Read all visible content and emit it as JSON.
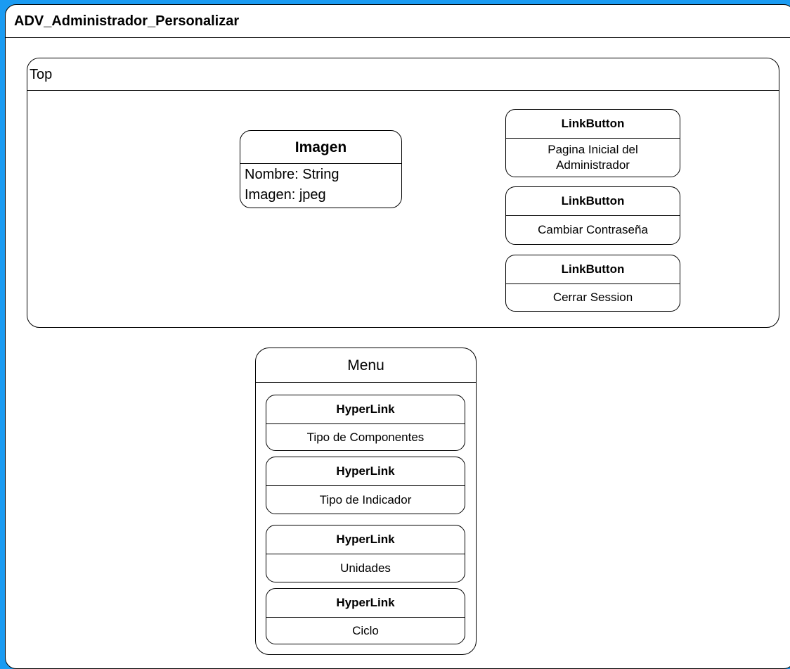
{
  "window": {
    "title": "ADV_Administrador_Personalizar"
  },
  "top": {
    "label": "Top",
    "entity": {
      "name": "Imagen",
      "attributes": [
        "Nombre: String",
        "Imagen: jpeg"
      ]
    },
    "link_buttons": [
      {
        "type": "LinkButton",
        "text": "Pagina Inicial del Administrador"
      },
      {
        "type": "LinkButton",
        "text": "Cambiar Contraseña"
      },
      {
        "type": "LinkButton",
        "text": "Cerrar Session"
      }
    ]
  },
  "menu": {
    "label": "Menu",
    "hyperlinks": [
      {
        "type": "HyperLink",
        "text": "Tipo de Componentes"
      },
      {
        "type": "HyperLink",
        "text": "Tipo de Indicador"
      },
      {
        "type": "HyperLink",
        "text": "Unidades"
      },
      {
        "type": "HyperLink",
        "text": "Ciclo"
      }
    ]
  },
  "colors": {
    "background": "#1a9bf2",
    "panel": "#ffffff",
    "border": "#000000"
  }
}
